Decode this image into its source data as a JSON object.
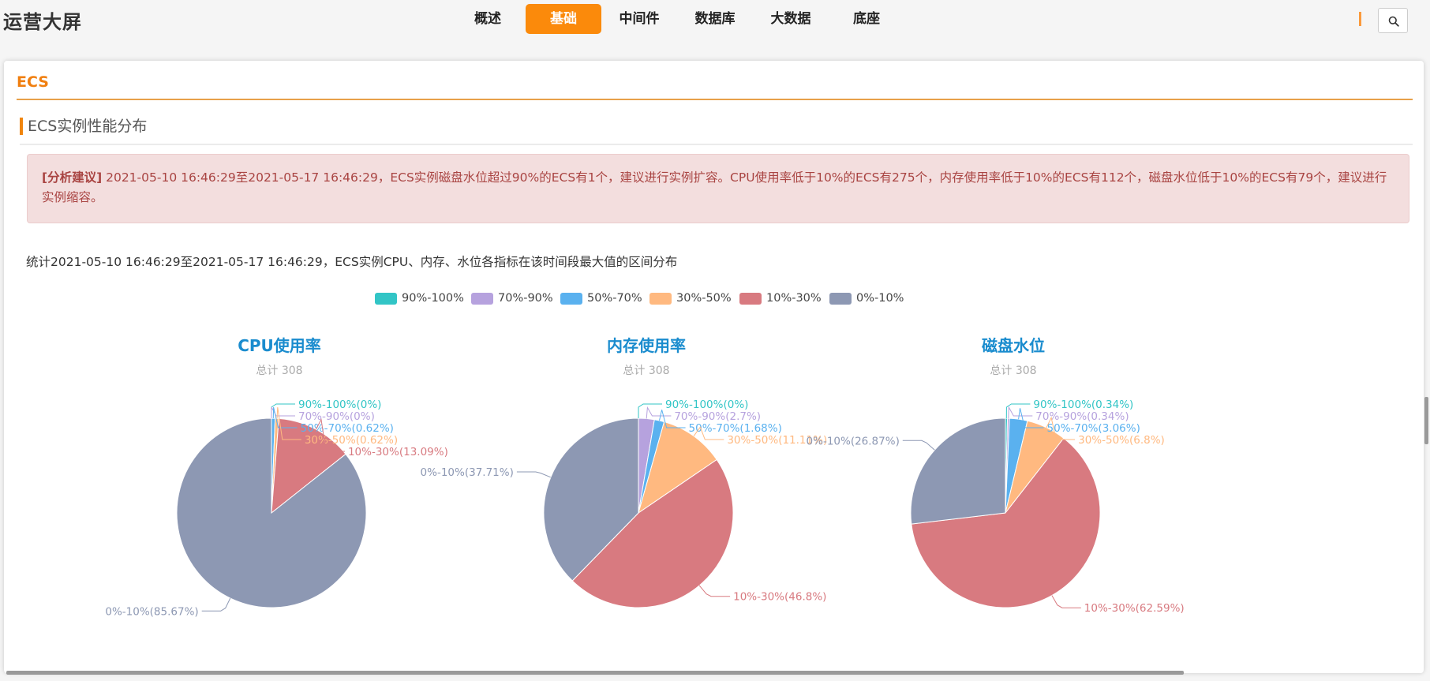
{
  "app": {
    "title": "运营大屏"
  },
  "nav": {
    "tabs": [
      "概述",
      "基础",
      "中间件",
      "数据库",
      "大数据",
      "底座"
    ],
    "active_index": 1
  },
  "card": {
    "header": "ECS",
    "section_title": "ECS实例性能分布"
  },
  "advice": {
    "tag": "[分析建议]",
    "text": " 2021-05-10 16:46:29至2021-05-17 16:46:29，ECS实例磁盘水位超过90%的ECS有1个，建议进行实例扩容。CPU使用率低于10%的ECS有275个，内存使用率低于10%的ECS有112个，磁盘水位低于10%的ECS有79个，建议进行实例缩容。"
  },
  "description": "统计2021-05-10 16:46:29至2021-05-17 16:46:29，ECS实例CPU、内存、水位各指标在该时间段最大值的区间分布",
  "icons": {
    "search": "search-icon"
  },
  "colors": {
    "accent": "#fb8a0b",
    "series": [
      "#32c5c6",
      "#b6a2de",
      "#5ab1ef",
      "#ffb980",
      "#d87a80",
      "#8d98b3"
    ]
  },
  "chart_data": [
    {
      "type": "pie",
      "title": "CPU使用率",
      "subtitle": "总计 308",
      "categories": [
        "90%-100%",
        "70%-90%",
        "50%-70%",
        "30%-50%",
        "10%-30%",
        "0%-10%"
      ],
      "values": [
        0,
        0,
        0.62,
        0.62,
        13.09,
        85.67
      ],
      "labels": [
        "90%-100%(0%)",
        "70%-90%(0%)",
        "50%-70%(0.62%)",
        "30%-50%(0.62%)",
        "10%-30%(13.09%)",
        "0%-10%(85.67%)"
      ],
      "legend": "top-center"
    },
    {
      "type": "pie",
      "title": "内存使用率",
      "subtitle": "总计 308",
      "categories": [
        "90%-100%",
        "70%-90%",
        "50%-70%",
        "30%-50%",
        "10%-30%",
        "0%-10%"
      ],
      "values": [
        0,
        2.7,
        1.68,
        11.11,
        46.8,
        37.71
      ],
      "labels": [
        "90%-100%(0%)",
        "70%-90%(2.7%)",
        "50%-70%(1.68%)",
        "30%-50%(11.11%)",
        "10%-30%(46.8%)",
        "0%-10%(37.71%)"
      ],
      "legend": "top-center"
    },
    {
      "type": "pie",
      "title": "磁盘水位",
      "subtitle": "总计 308",
      "categories": [
        "90%-100%",
        "70%-90%",
        "50%-70%",
        "30%-50%",
        "10%-30%",
        "0%-10%"
      ],
      "values": [
        0.34,
        0.34,
        3.06,
        6.8,
        62.59,
        26.87
      ],
      "labels": [
        "90%-100%(0.34%)",
        "70%-90%(0.34%)",
        "50%-70%(3.06%)",
        "30%-50%(6.8%)",
        "10%-30%(62.59%)",
        "0%-10%(26.87%)"
      ],
      "legend": "top-center"
    }
  ]
}
